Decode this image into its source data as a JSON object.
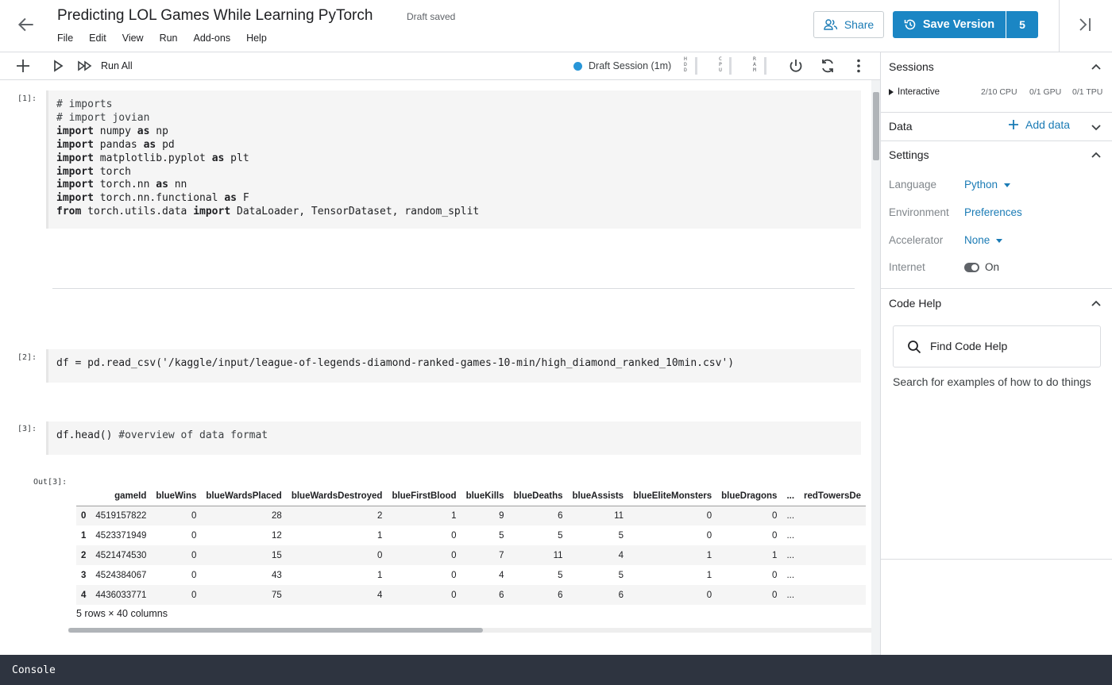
{
  "header": {
    "title": "Predicting LOL Games While Learning PyTorch",
    "status": "Draft saved",
    "menu": [
      "File",
      "Edit",
      "View",
      "Run",
      "Add-ons",
      "Help"
    ],
    "share_label": "Share",
    "save_label": "Save Version",
    "save_count": "5"
  },
  "toolbar": {
    "run_all_label": "Run All",
    "session_label": "Draft Session (1m)",
    "meters": [
      "HDD",
      "CPU",
      "RAM"
    ]
  },
  "cells": [
    {
      "label": "[1]:",
      "lines": [
        [
          {
            "t": "# imports",
            "c": "cm"
          }
        ],
        [
          {
            "t": "# import jovian",
            "c": "cm"
          }
        ],
        [
          {
            "t": "import",
            "c": "kw"
          },
          {
            "t": " numpy ",
            "c": ""
          },
          {
            "t": "as",
            "c": "kw"
          },
          {
            "t": " np",
            "c": ""
          }
        ],
        [
          {
            "t": "import",
            "c": "kw"
          },
          {
            "t": " pandas ",
            "c": ""
          },
          {
            "t": "as",
            "c": "kw"
          },
          {
            "t": " pd",
            "c": ""
          }
        ],
        [
          {
            "t": "import",
            "c": "kw"
          },
          {
            "t": " matplotlib.pyplot ",
            "c": ""
          },
          {
            "t": "as",
            "c": "kw"
          },
          {
            "t": " plt",
            "c": ""
          }
        ],
        [
          {
            "t": "import",
            "c": "kw"
          },
          {
            "t": " torch",
            "c": ""
          }
        ],
        [
          {
            "t": "import",
            "c": "kw"
          },
          {
            "t": " torch.nn ",
            "c": ""
          },
          {
            "t": "as",
            "c": "kw"
          },
          {
            "t": " nn",
            "c": ""
          }
        ],
        [
          {
            "t": "import",
            "c": "kw"
          },
          {
            "t": " torch.nn.functional ",
            "c": ""
          },
          {
            "t": "as",
            "c": "kw"
          },
          {
            "t": " F",
            "c": ""
          }
        ],
        [
          {
            "t": "from",
            "c": "kw"
          },
          {
            "t": " torch.utils.data ",
            "c": ""
          },
          {
            "t": "import",
            "c": "kw"
          },
          {
            "t": " DataLoader, TensorDataset, random_split",
            "c": ""
          }
        ]
      ]
    },
    {
      "label": "[2]:",
      "lines": [
        [
          {
            "t": "df = pd.read_csv('/kaggle/input/league-of-legends-diamond-ranked-games-10-min/high_diamond_ranked_10min.csv')",
            "c": ""
          }
        ]
      ]
    },
    {
      "label": "[3]:",
      "lines": [
        [
          {
            "t": "df.head() ",
            "c": ""
          },
          {
            "t": "#overview of data format",
            "c": "cm"
          }
        ]
      ]
    }
  ],
  "output": {
    "label": "Out[3]:",
    "columns": [
      "",
      "gameId",
      "blueWins",
      "blueWardsPlaced",
      "blueWardsDestroyed",
      "blueFirstBlood",
      "blueKills",
      "blueDeaths",
      "blueAssists",
      "blueEliteMonsters",
      "blueDragons",
      "...",
      "redTowersDe"
    ],
    "rows": [
      [
        "0",
        "4519157822",
        "0",
        "28",
        "2",
        "1",
        "9",
        "6",
        "11",
        "0",
        "0",
        "...",
        ""
      ],
      [
        "1",
        "4523371949",
        "0",
        "12",
        "1",
        "0",
        "5",
        "5",
        "5",
        "0",
        "0",
        "...",
        ""
      ],
      [
        "2",
        "4521474530",
        "0",
        "15",
        "0",
        "0",
        "7",
        "11",
        "4",
        "1",
        "1",
        "...",
        ""
      ],
      [
        "3",
        "4524384067",
        "0",
        "43",
        "1",
        "0",
        "4",
        "5",
        "5",
        "1",
        "0",
        "...",
        ""
      ],
      [
        "4",
        "4436033771",
        "0",
        "75",
        "4",
        "0",
        "6",
        "6",
        "6",
        "0",
        "0",
        "...",
        ""
      ]
    ],
    "caption": "5 rows × 40 columns"
  },
  "sidebar": {
    "sessions_title": "Sessions",
    "session_name": "Interactive",
    "cpu": "2/10 CPU",
    "gpu": "0/1 GPU",
    "tpu": "0/1 TPU",
    "data_title": "Data",
    "add_data": "Add data",
    "settings_title": "Settings",
    "language_key": "Language",
    "language_val": "Python",
    "environment_key": "Environment",
    "environment_val": "Preferences",
    "accelerator_key": "Accelerator",
    "accelerator_val": "None",
    "internet_key": "Internet",
    "internet_val": "On",
    "codehelp_title": "Code Help",
    "find_label": "Find Code Help",
    "find_hint": "Search for examples of how to do things"
  },
  "console": {
    "label": "Console"
  },
  "colors": {
    "accent": "#1b86c4",
    "link": "#1a7bb5",
    "console_bg": "#2e3440"
  }
}
